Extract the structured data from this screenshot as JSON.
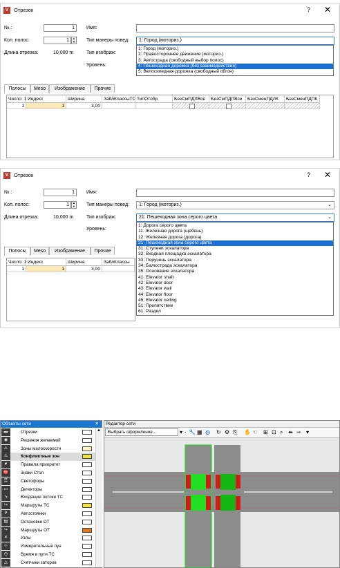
{
  "dialog1": {
    "title": "Отрезок",
    "help": "?",
    "close": "✕",
    "no_label": "№.:",
    "no_value": "1",
    "lanes_label": "Кол. полос:",
    "lanes_value": "1",
    "length_label": "Длина отрезка:",
    "length_value": "10,000 m",
    "name_label": "Имя:",
    "name_value": "",
    "behavior_label": "Тип манеры повед:",
    "behavior_value": "1: Город (моториз.)",
    "display_label": "Тип изображ:",
    "level_label": "Уровень:",
    "behavior_options": [
      "1: Город (моториз.)",
      "2: Правостороннее движение (моториз.)",
      "3: Автострада (свободный выбор полос)",
      "4: Пешеходная дорожка (без взаимодействия)",
      "5: Велосипедная дорожка (свободный обгон)"
    ],
    "behavior_selected_index": 3,
    "tabs": [
      "Полосы",
      "Meso",
      "Изображение",
      "Прочие"
    ],
    "columns": [
      "Число: 1",
      "Индекс",
      "Ширина",
      "ЗаблКлассыТС",
      "ТипОтобр",
      "БезСмПДЛВсе",
      "БезСмПДПВсе",
      "БезСменПДЛК",
      "БезСменПДПК"
    ],
    "row": [
      "1",
      "1",
      "3,00",
      "",
      "",
      "",
      "",
      "",
      ""
    ]
  },
  "dialog2": {
    "title": "Отрезок",
    "help": "?",
    "close": "✕",
    "no_label": "№.:",
    "no_value": "1",
    "lanes_label": "Кол. полос:",
    "lanes_value": "1",
    "length_label": "Длина отрезка:",
    "length_value": "10,000 m",
    "name_label": "Имя:",
    "name_value": "",
    "behavior_label": "Тип манеры повед:",
    "behavior_value": "1: Город (моториз.)",
    "display_label": "Тип изображ:",
    "display_value": "21: Пешеходная зона серого цвета",
    "level_label": "Уровень:",
    "display_options": [
      "1: Дорога серого цвета",
      "11: Железная дорога (щебень)",
      "12: Железная дорога (дорога)",
      "21: Пешеходная зона серого цвета",
      "31: Ступени эскалатора",
      "32: Входная площадка эскалатора",
      "33: Поручень эскалатора",
      "34: Балюстрада эскалатора",
      "35: Основание эскалатора",
      "41: Elevator shaft",
      "42: Elevator door",
      "43: Elevator wall",
      "44: Elevator floor",
      "45: Elevator ceiling",
      "51: Препятствие",
      "61: Раздел"
    ],
    "display_selected_index": 3,
    "tabs": [
      "Полосы",
      "Meso",
      "Изображение",
      "Прочие"
    ],
    "columns": [
      "Число: 1",
      "Индекс",
      "Ширина",
      "ЗаблКлассы"
    ],
    "row": [
      "1",
      "1",
      "3,00",
      ""
    ]
  },
  "objects_panel": {
    "title": "Объекты сети",
    "items": [
      {
        "label": "Отрезки",
        "icon": "link-icon",
        "swatch": "#ffffff",
        "bold": false
      },
      {
        "label": "Решения желаемой",
        "icon": "decision-icon",
        "swatch": "",
        "bold": false
      },
      {
        "label": "Зоны малоскоростн",
        "icon": "slow-zone-icon",
        "swatch": "#fff6c8",
        "bold": false
      },
      {
        "label": "Конфликтные зон",
        "icon": "conflict-icon",
        "swatch": "#e8e24a",
        "bold": true
      },
      {
        "label": "Правила приоритет",
        "icon": "priority-icon",
        "swatch": "#ffffff",
        "bold": false
      },
      {
        "label": "Знаки Стоп",
        "icon": "stop-sign-icon",
        "swatch": "#ffffff",
        "bold": false
      },
      {
        "label": "Светофоры",
        "icon": "traffic-light-icon",
        "swatch": "#ffffff",
        "bold": false
      },
      {
        "label": "Детекторы",
        "icon": "detector-icon",
        "swatch": "#ffffff",
        "bold": false
      },
      {
        "label": "Входящие потоки ТС",
        "icon": "input-icon",
        "swatch": "#ffffff",
        "bold": false
      },
      {
        "label": "Маршруты ТС",
        "icon": "route-icon",
        "swatch": "#f2e34a",
        "bold": false
      },
      {
        "label": "Автостоянки",
        "icon": "parking-icon",
        "swatch": "#ffffff",
        "bold": false
      },
      {
        "label": "Остановки ОТ",
        "icon": "bus-stop-icon",
        "swatch": "#ffffff",
        "bold": false
      },
      {
        "label": "Маршруты ОТ",
        "icon": "pt-route-icon",
        "swatch": "#e07a20",
        "bold": false
      },
      {
        "label": "Узлы",
        "icon": "node-icon",
        "swatch": "#ffffff",
        "bold": false
      },
      {
        "label": "Измерительные пун",
        "icon": "measure-icon",
        "swatch": "#ffffff",
        "bold": false
      },
      {
        "label": "Время в пути ТС",
        "icon": "travel-time-icon",
        "swatch": "#ffffff",
        "bold": false
      },
      {
        "label": "Счетчики заторов",
        "icon": "queue-counter-icon",
        "swatch": "#ffffff",
        "bold": false
      }
    ]
  },
  "editor": {
    "title": "Редактор сети",
    "style_select": "Выбрать оформление..."
  },
  "colors": {
    "selection_blue": "#1e6fd0",
    "green_zone": "#22dd22",
    "red_block": "#d11a1a",
    "road_gray": "#8c8c8c"
  }
}
